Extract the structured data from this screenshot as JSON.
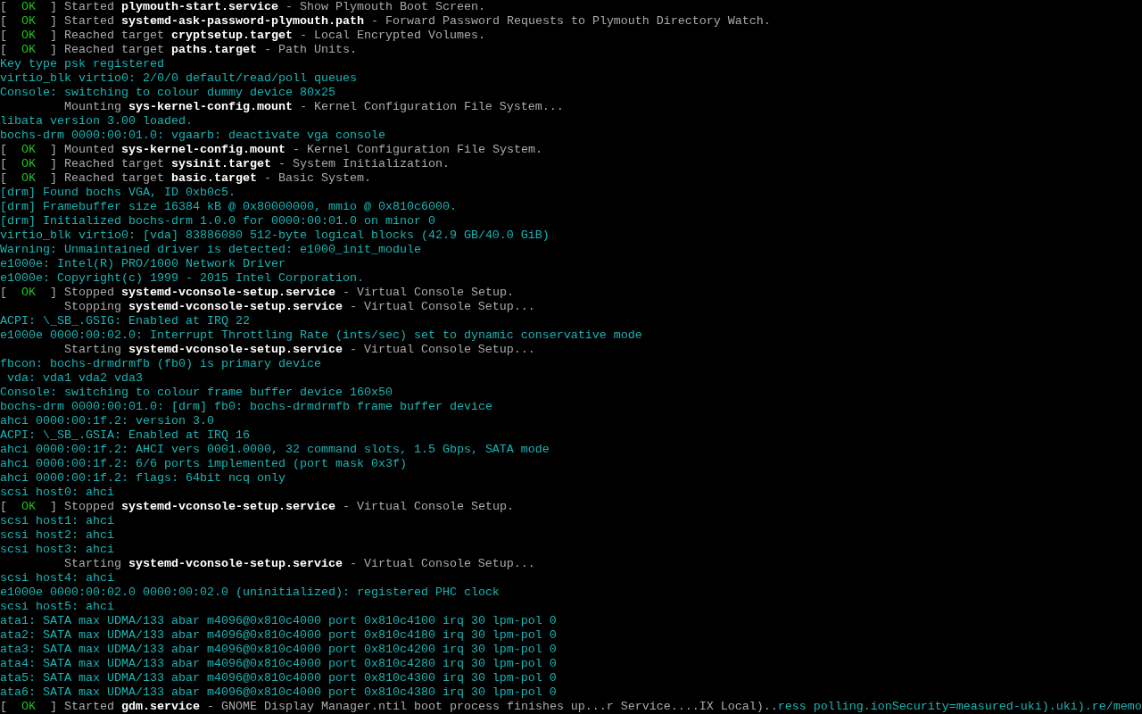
{
  "console": {
    "lines": [
      {
        "kind": "status",
        "open": "[",
        "result": "OK",
        "close": "]",
        "message": "Started",
        "unit": "plymouth-start.service",
        "description": "- Show Plymouth Boot Screen."
      },
      {
        "kind": "status",
        "open": "[",
        "result": "OK",
        "close": "]",
        "message": "Started",
        "unit": "systemd-ask-password-plymouth.path",
        "description": "- Forward Password Requests to Plymouth Directory Watch."
      },
      {
        "kind": "status",
        "open": "[",
        "result": "OK",
        "close": "]",
        "message": "Reached target",
        "unit": "cryptsetup.target",
        "description": "- Local Encrypted Volumes."
      },
      {
        "kind": "status",
        "open": "[",
        "result": "OK",
        "close": "]",
        "message": "Reached target",
        "unit": "paths.target",
        "description": "- Path Units."
      },
      {
        "kind": "kernel",
        "text": "Key type psk registered"
      },
      {
        "kind": "kernel",
        "text": "virtio_blk virtio0: 2/0/0 default/read/poll queues"
      },
      {
        "kind": "kernel",
        "text": "Console: switching to colour dummy device 80x25"
      },
      {
        "kind": "job",
        "message": "Mounting",
        "unit": "sys-kernel-config.mount",
        "description": "- Kernel Configuration File System..."
      },
      {
        "kind": "kernel",
        "text": "libata version 3.00 loaded."
      },
      {
        "kind": "kernel",
        "text": "bochs-drm 0000:00:01.0: vgaarb: deactivate vga console"
      },
      {
        "kind": "status",
        "open": "[",
        "result": "OK",
        "close": "]",
        "message": "Mounted",
        "unit": "sys-kernel-config.mount",
        "description": "- Kernel Configuration File System."
      },
      {
        "kind": "status",
        "open": "[",
        "result": "OK",
        "close": "]",
        "message": "Reached target",
        "unit": "sysinit.target",
        "description": "- System Initialization."
      },
      {
        "kind": "status",
        "open": "[",
        "result": "OK",
        "close": "]",
        "message": "Reached target",
        "unit": "basic.target",
        "description": "- Basic System."
      },
      {
        "kind": "kernel",
        "text": "[drm] Found bochs VGA, ID 0xb0c5."
      },
      {
        "kind": "kernel",
        "text": "[drm] Framebuffer size 16384 kB @ 0x80000000, mmio @ 0x810c6000."
      },
      {
        "kind": "kernel",
        "text": "[drm] Initialized bochs-drm 1.0.0 for 0000:00:01.0 on minor 0"
      },
      {
        "kind": "kernel",
        "text": "virtio_blk virtio0: [vda] 83886080 512-byte logical blocks (42.9 GB/40.0 GiB)"
      },
      {
        "kind": "kernel",
        "text": "Warning: Unmaintained driver is detected: e1000_init_module"
      },
      {
        "kind": "kernel",
        "text": "e1000e: Intel(R) PRO/1000 Network Driver"
      },
      {
        "kind": "kernel",
        "text": "e1000e: Copyright(c) 1999 - 2015 Intel Corporation."
      },
      {
        "kind": "status",
        "open": "[",
        "result": "OK",
        "close": "]",
        "message": "Stopped",
        "unit": "systemd-vconsole-setup.service",
        "description": "- Virtual Console Setup."
      },
      {
        "kind": "job",
        "message": "Stopping",
        "unit": "systemd-vconsole-setup.service",
        "description": "- Virtual Console Setup..."
      },
      {
        "kind": "kernel",
        "text": "ACPI: \\_SB_.GSIG: Enabled at IRQ 22"
      },
      {
        "kind": "kernel",
        "text": "e1000e 0000:00:02.0: Interrupt Throttling Rate (ints/sec) set to dynamic conservative mode"
      },
      {
        "kind": "job",
        "message": "Starting",
        "unit": "systemd-vconsole-setup.service",
        "description": "- Virtual Console Setup..."
      },
      {
        "kind": "kernel",
        "text": "fbcon: bochs-drmdrmfb (fb0) is primary device"
      },
      {
        "kind": "kernel",
        "text": " vda: vda1 vda2 vda3"
      },
      {
        "kind": "kernel",
        "text": "Console: switching to colour frame buffer device 160x50"
      },
      {
        "kind": "kernel",
        "text": "bochs-drm 0000:00:01.0: [drm] fb0: bochs-drmdrmfb frame buffer device"
      },
      {
        "kind": "kernel",
        "text": "ahci 0000:00:1f.2: version 3.0"
      },
      {
        "kind": "kernel",
        "text": "ACPI: \\_SB_.GSIA: Enabled at IRQ 16"
      },
      {
        "kind": "kernel",
        "text": "ahci 0000:00:1f.2: AHCI vers 0001.0000, 32 command slots, 1.5 Gbps, SATA mode"
      },
      {
        "kind": "kernel",
        "text": "ahci 0000:00:1f.2: 6/6 ports implemented (port mask 0x3f)"
      },
      {
        "kind": "kernel",
        "text": "ahci 0000:00:1f.2: flags: 64bit ncq only"
      },
      {
        "kind": "kernel",
        "text": "scsi host0: ahci"
      },
      {
        "kind": "status",
        "open": "[",
        "result": "OK",
        "close": "]",
        "message": "Stopped",
        "unit": "systemd-vconsole-setup.service",
        "description": "- Virtual Console Setup."
      },
      {
        "kind": "kernel",
        "text": "scsi host1: ahci"
      },
      {
        "kind": "kernel",
        "text": "scsi host2: ahci"
      },
      {
        "kind": "kernel",
        "text": "scsi host3: ahci"
      },
      {
        "kind": "job",
        "message": "Starting",
        "unit": "systemd-vconsole-setup.service",
        "description": "- Virtual Console Setup..."
      },
      {
        "kind": "kernel",
        "text": "scsi host4: ahci"
      },
      {
        "kind": "kernel",
        "text": "e1000e 0000:00:02.0 0000:00:02.0 (uninitialized): registered PHC clock"
      },
      {
        "kind": "kernel",
        "text": "scsi host5: ahci"
      },
      {
        "kind": "kernel",
        "text": "ata1: SATA max UDMA/133 abar m4096@0x810c4000 port 0x810c4100 irq 30 lpm-pol 0"
      },
      {
        "kind": "kernel",
        "text": "ata2: SATA max UDMA/133 abar m4096@0x810c4000 port 0x810c4180 irq 30 lpm-pol 0"
      },
      {
        "kind": "kernel",
        "text": "ata3: SATA max UDMA/133 abar m4096@0x810c4000 port 0x810c4200 irq 30 lpm-pol 0"
      },
      {
        "kind": "kernel",
        "text": "ata4: SATA max UDMA/133 abar m4096@0x810c4000 port 0x810c4280 irq 30 lpm-pol 0"
      },
      {
        "kind": "kernel",
        "text": "ata5: SATA max UDMA/133 abar m4096@0x810c4000 port 0x810c4300 irq 30 lpm-pol 0"
      },
      {
        "kind": "kernel",
        "text": "ata6: SATA max UDMA/133 abar m4096@0x810c4000 port 0x810c4380 irq 30 lpm-pol 0"
      },
      {
        "kind": "status",
        "open": "[",
        "result": "OK",
        "close": "]",
        "message": "Started",
        "unit": "gdm.service",
        "description": "- GNOME Display Manager.ntil boot process finishes up...r Service....IX Local)..",
        "overwritten": "ress polling.ionSecurity=measured-uki).uki).re/memo"
      }
    ]
  }
}
